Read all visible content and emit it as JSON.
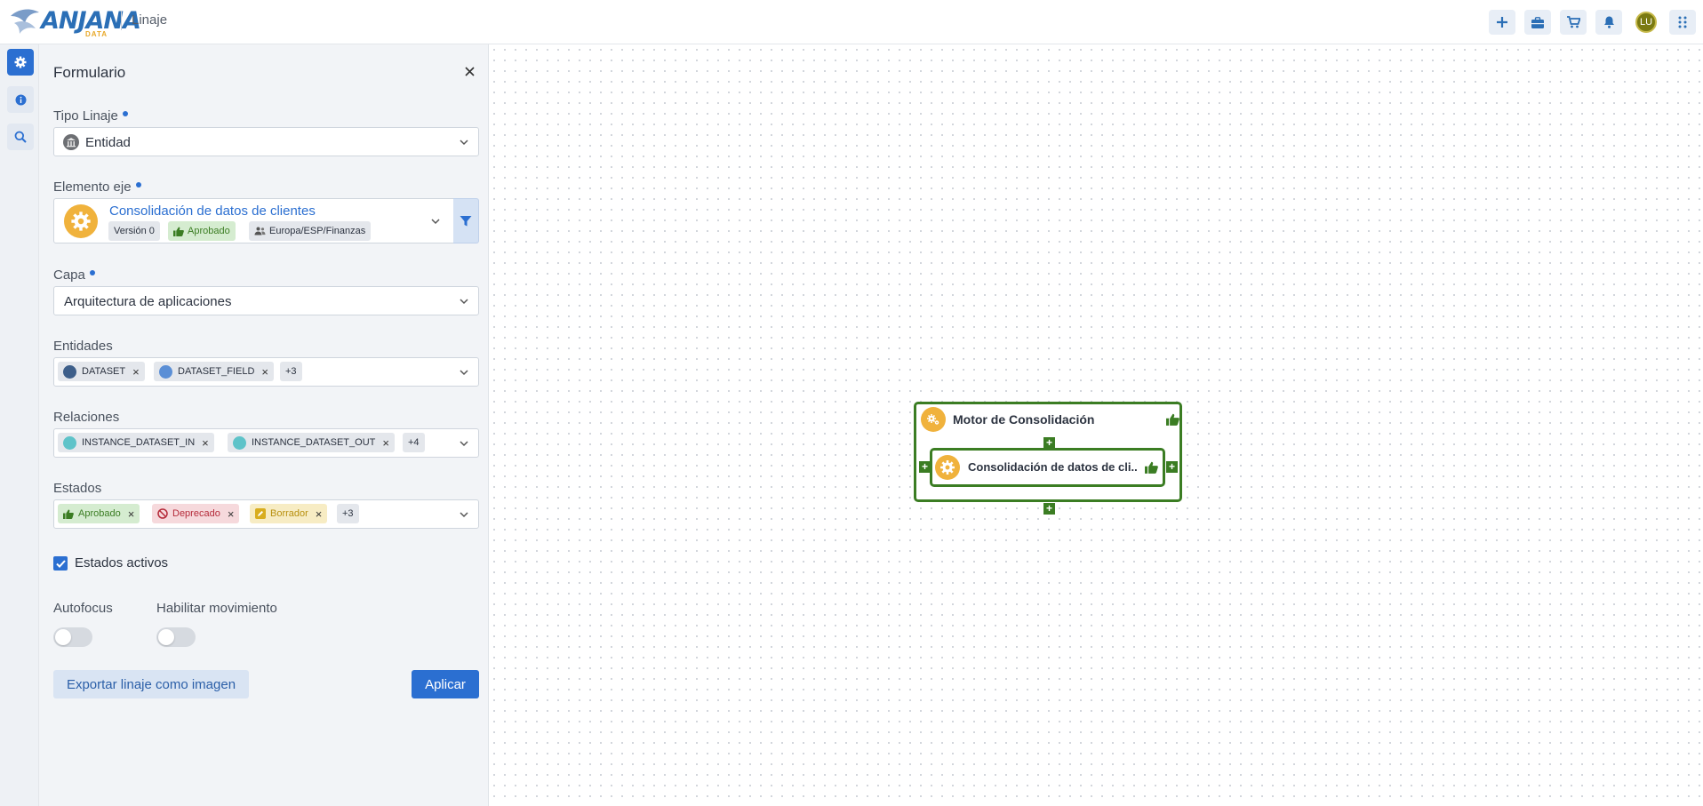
{
  "header": {
    "logo_text": "ANJANA",
    "logo_sub": "DATA",
    "title": "Linaje",
    "avatar": "LU"
  },
  "form": {
    "title": "Formulario",
    "tipo_linaje": {
      "label": "Tipo Linaje",
      "value": "Entidad"
    },
    "elemento_eje": {
      "label": "Elemento eje",
      "name": "Consolidación de datos de clientes",
      "version": "Versión 0",
      "status": "Aprobado",
      "path": "Europa/ESP/Finanzas"
    },
    "capa": {
      "label": "Capa",
      "value": "Arquitectura de aplicaciones"
    },
    "entidades": {
      "label": "Entidades",
      "tags": [
        "DATASET",
        "DATASET_FIELD"
      ],
      "more": "+3"
    },
    "relaciones": {
      "label": "Relaciones",
      "tags": [
        "INSTANCE_DATASET_IN",
        "INSTANCE_DATASET_OUT"
      ],
      "more": "+4"
    },
    "estados": {
      "label": "Estados",
      "tags": [
        "Aprobado",
        "Deprecado",
        "Borrador"
      ],
      "more": "+3"
    },
    "estados_activos": "Estados activos",
    "autofocus": "Autofocus",
    "habilitar_movimiento": "Habilitar movimiento",
    "export_button": "Exportar linaje como imagen",
    "apply_button": "Aplicar"
  },
  "graph": {
    "outer_node": "Motor de Consolidación",
    "inner_node": "Consolidación de datos de cli.."
  },
  "colors": {
    "primary": "#2b6fd1",
    "approved": "#3b7d23",
    "deprecated": "#c0392b",
    "draft": "#c89b12"
  }
}
